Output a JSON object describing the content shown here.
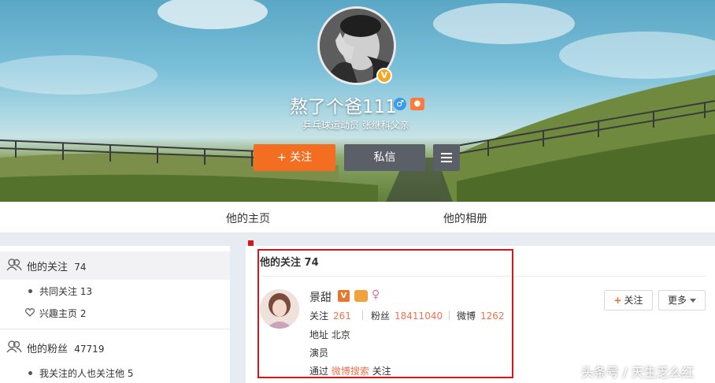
{
  "profile": {
    "username": "熬了个爸111",
    "description": "乒乓球运动员 张继科父亲",
    "verified_badge": "V",
    "gender_symbol": "♂",
    "follow_button": "+ 关注",
    "message_button": "私信"
  },
  "tabs": [
    "他的主页",
    "他的相册"
  ],
  "sidebar": {
    "following": {
      "label": "他的关注",
      "count": "74"
    },
    "common_following": {
      "label": "共同关注",
      "count": "13"
    },
    "interest_pages": {
      "label": "兴趣主页",
      "count": "2"
    },
    "fans": {
      "label": "他的粉丝",
      "count": "47719"
    },
    "mutual_fans": {
      "label": "我关注的人也关注他",
      "count": "5"
    }
  },
  "main": {
    "title": "他的关注 74",
    "user": {
      "name": "景甜",
      "verified_badge": "V",
      "stats": [
        {
          "label": "关注",
          "value": "261"
        },
        {
          "label": "粉丝",
          "value": "18411040"
        },
        {
          "label": "微博",
          "value": "1262"
        }
      ],
      "location_label": "地址",
      "location": "北京",
      "occupation": "演员",
      "via_prefix": "通过",
      "via_link": "微博搜索",
      "via_suffix": "关注",
      "follow_button": "关注",
      "follow_plus": "+",
      "more_button": "更多"
    }
  },
  "watermark": "头条号 / 天生乏么红",
  "colors": {
    "accent_orange": "#f46e22",
    "button_gray": "#5b6068",
    "highlight_red": "#d5171c",
    "link_orange": "#eb7350"
  }
}
